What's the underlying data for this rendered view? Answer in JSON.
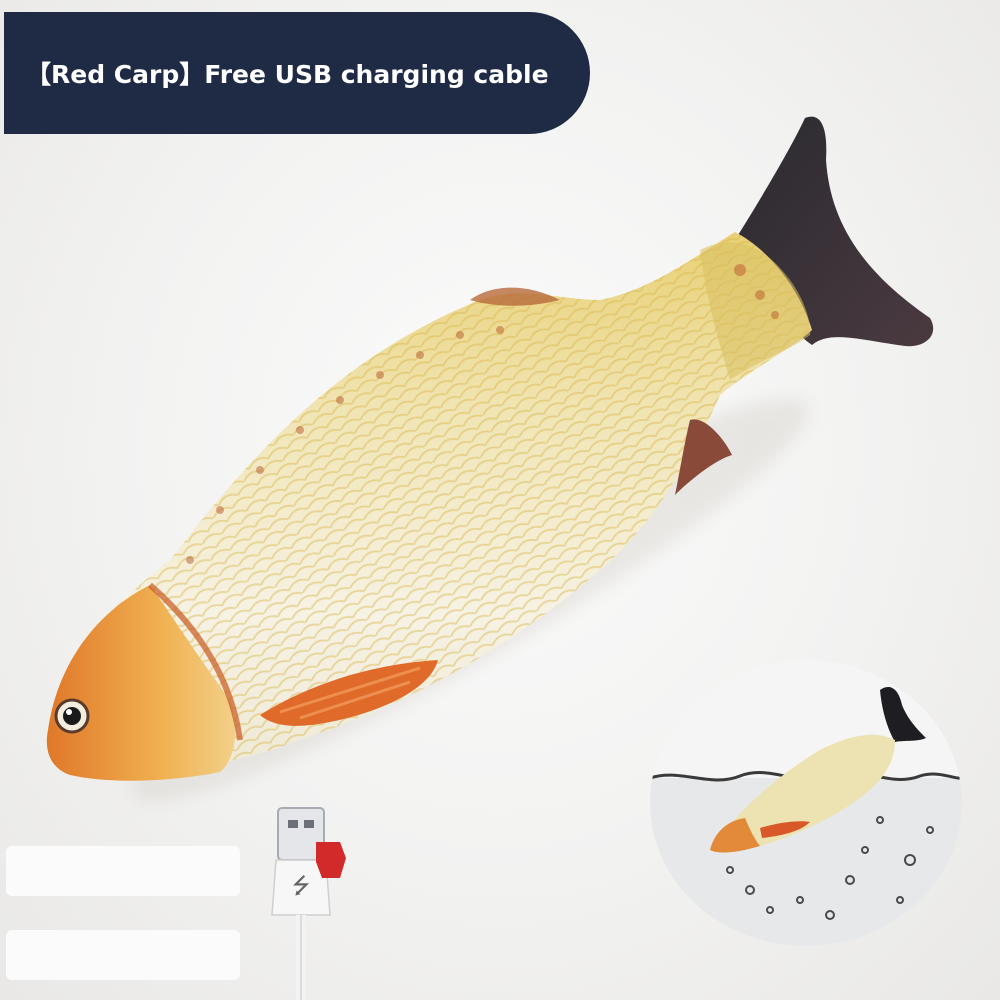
{
  "banner": {
    "title": "【Red Carp】Free USB charging cable",
    "color": "#1f2a44"
  },
  "product": {
    "image": "red-carp-plush-fish-toy",
    "accessory": "usb-charging-cable",
    "inset": "fish-in-water"
  }
}
